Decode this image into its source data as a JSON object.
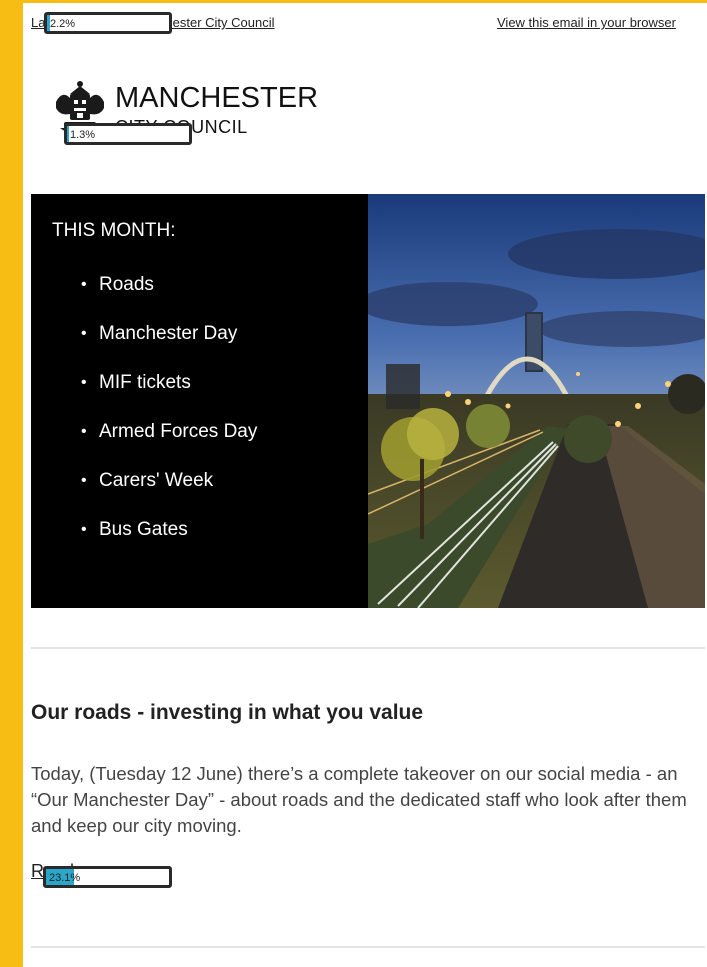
{
  "header": {
    "latest_news_link": "Latest news from Manchester City Council",
    "view_in_browser_link": "View this email in your browser"
  },
  "overlays": {
    "top_progress": {
      "label": "2.2%",
      "fraction": 0.022
    },
    "logo_progress": {
      "label": "1.3%",
      "fraction": 0.013
    },
    "read_more_progress": {
      "label": "23.1%",
      "fraction": 0.231,
      "fill_color": "#29a6c9"
    }
  },
  "logo": {
    "title": "MANCHESTER",
    "subtitle": "CITY COUNCIL",
    "icon": "city-crest-icon"
  },
  "hero": {
    "heading": "THIS MONTH:",
    "items": [
      "Roads",
      "Manchester Day",
      "MIF tickets",
      "Armed Forces Day",
      "Carers' Week",
      "Bus Gates"
    ],
    "image": "night-city-road-image"
  },
  "article": {
    "title": "Our roads - investing in what you value",
    "body": "Today, (Tuesday 12 June) there’s a complete takeover on our social media - an “Our Manchester Day” - about roads and the dedicated staff who look after them and keep our city moving.",
    "read_more": "Read more"
  },
  "colors": {
    "accent_bar": "#f7bd14",
    "hero_background": "#000000",
    "progress_fill": "#29a6c9"
  }
}
